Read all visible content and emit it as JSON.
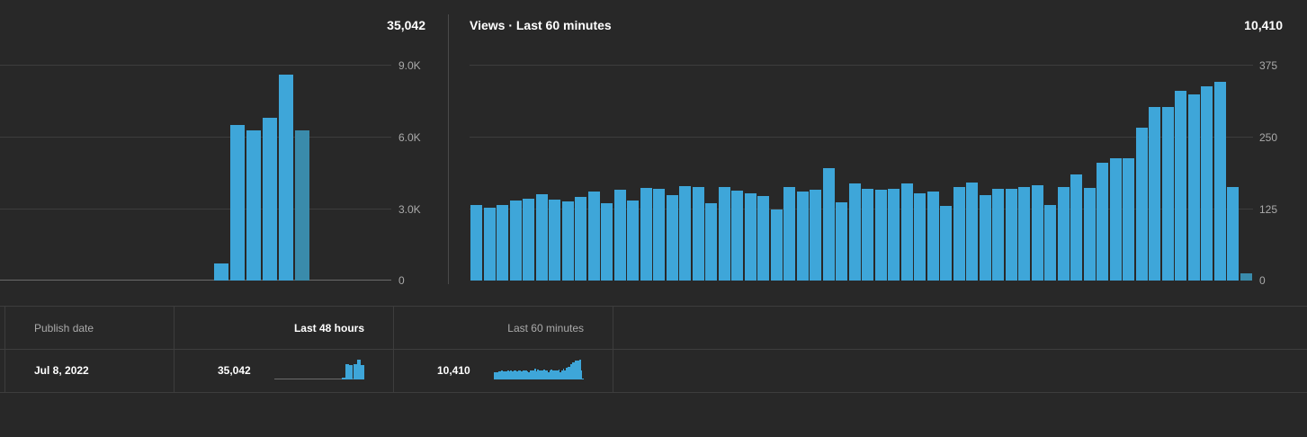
{
  "left_chart": {
    "total": "35,042",
    "ticks": [
      "9.0K",
      "6.0K",
      "3.0K",
      "0"
    ]
  },
  "right_chart": {
    "title": "Views · Last 60 minutes",
    "total": "10,410",
    "ticks": [
      "375",
      "250",
      "125",
      "0"
    ]
  },
  "table": {
    "headers": {
      "publish_date": "Publish date",
      "last_48": "Last 48 hours",
      "last_60": "Last 60 minutes"
    },
    "row": {
      "publish_date": "Jul 8, 2022",
      "views_48": "35,042",
      "views_60": "10,410"
    }
  },
  "colors": {
    "bar": "#3ea6d9",
    "bar_current": "#3a8bab",
    "background": "#282828"
  },
  "chart_data": [
    {
      "type": "bar",
      "title": "",
      "ylim": [
        0,
        9000
      ],
      "y_ticks": [
        0,
        3000,
        6000,
        9000
      ],
      "values": [
        0,
        0,
        0,
        0,
        0,
        0,
        0,
        0,
        0,
        0,
        0,
        0,
        0,
        0,
        0,
        0,
        0,
        0,
        700,
        6500,
        6250,
        6800,
        8600,
        6250
      ],
      "current_index": 23,
      "total": 35042
    },
    {
      "type": "bar",
      "title": "Views · Last 60 minutes",
      "ylim": [
        0,
        375
      ],
      "y_ticks": [
        0,
        125,
        250,
        375
      ],
      "values": [
        131,
        127,
        132,
        139,
        142,
        150,
        141,
        137,
        146,
        155,
        134,
        158,
        139,
        161,
        160,
        148,
        164,
        162,
        134,
        163,
        156,
        151,
        147,
        124,
        163,
        155,
        158,
        195,
        136,
        169,
        160,
        158,
        159,
        169,
        152,
        155,
        129,
        162,
        171,
        149,
        160,
        160,
        163,
        166,
        131,
        162,
        184,
        161,
        205,
        213,
        212,
        265,
        301,
        302,
        329,
        324,
        337,
        345,
        163,
        13
      ],
      "current_index": 59,
      "total": 10410
    }
  ],
  "sparklines": {
    "last_48": [
      0,
      0,
      0,
      0,
      0,
      0,
      0,
      0,
      0,
      0,
      0,
      0,
      0,
      0,
      0,
      0,
      0,
      0,
      700,
      6500,
      6250,
      6800,
      8600,
      6250
    ],
    "last_60": [
      131,
      127,
      132,
      139,
      142,
      150,
      141,
      137,
      146,
      155,
      134,
      158,
      139,
      161,
      160,
      148,
      164,
      162,
      134,
      163,
      156,
      151,
      147,
      124,
      163,
      155,
      158,
      195,
      136,
      169,
      160,
      158,
      159,
      169,
      152,
      155,
      129,
      162,
      171,
      149,
      160,
      160,
      163,
      166,
      131,
      162,
      184,
      161,
      205,
      213,
      212,
      265,
      301,
      302,
      329,
      324,
      337,
      345,
      163,
      13
    ]
  }
}
